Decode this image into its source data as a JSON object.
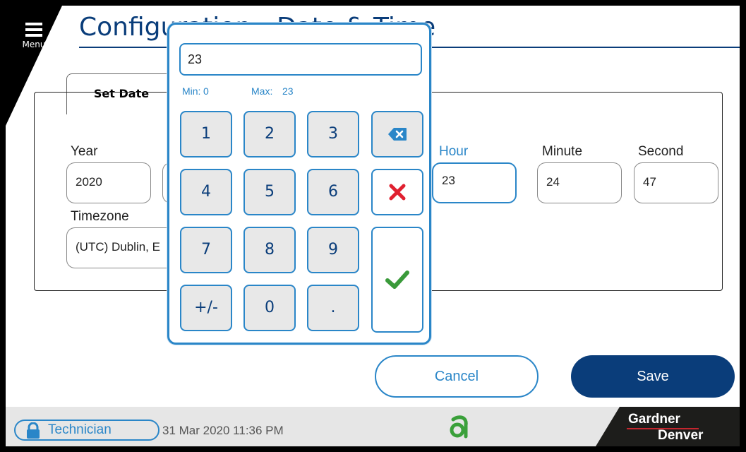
{
  "header": {
    "menu_label": "Menu",
    "title": "Configuration - Date & Time"
  },
  "tabs": {
    "set_date_label": "Set Date"
  },
  "fields": {
    "year_label": "Year",
    "year_value": "2020",
    "hour_label": "Hour",
    "hour_value": "23",
    "minute_label": "Minute",
    "minute_value": "24",
    "second_label": "Second",
    "second_value": "47",
    "timezone_label": "Timezone",
    "timezone_value": "(UTC) Dublin, E"
  },
  "keypad": {
    "display_value": "23",
    "min_label": "Min:",
    "min_value": "0",
    "max_label": "Max:",
    "max_value": "23",
    "keys": [
      "1",
      "2",
      "3",
      "4",
      "5",
      "6",
      "7",
      "8",
      "9",
      "+/-",
      "0",
      "."
    ]
  },
  "actions": {
    "cancel_label": "Cancel",
    "save_label": "Save"
  },
  "status": {
    "user_role": "Technician",
    "datetime": "31 Mar 2020 11:36 PM",
    "brand_line1": "Gardner",
    "brand_line2": "Denver"
  },
  "colors": {
    "primary_navy": "#0a3d7a",
    "accent_blue": "#2a86c8",
    "cancel_red": "#e02030",
    "confirm_green": "#3a9a3a",
    "brand_green": "#3aa03a",
    "brand_red": "#c3262e"
  },
  "icons": {
    "menu": "hamburger-icon",
    "backspace": "backspace-icon",
    "clear": "x-icon",
    "confirm": "checkmark-icon",
    "lock": "lock-icon",
    "brand": "brand-logo-icon"
  }
}
